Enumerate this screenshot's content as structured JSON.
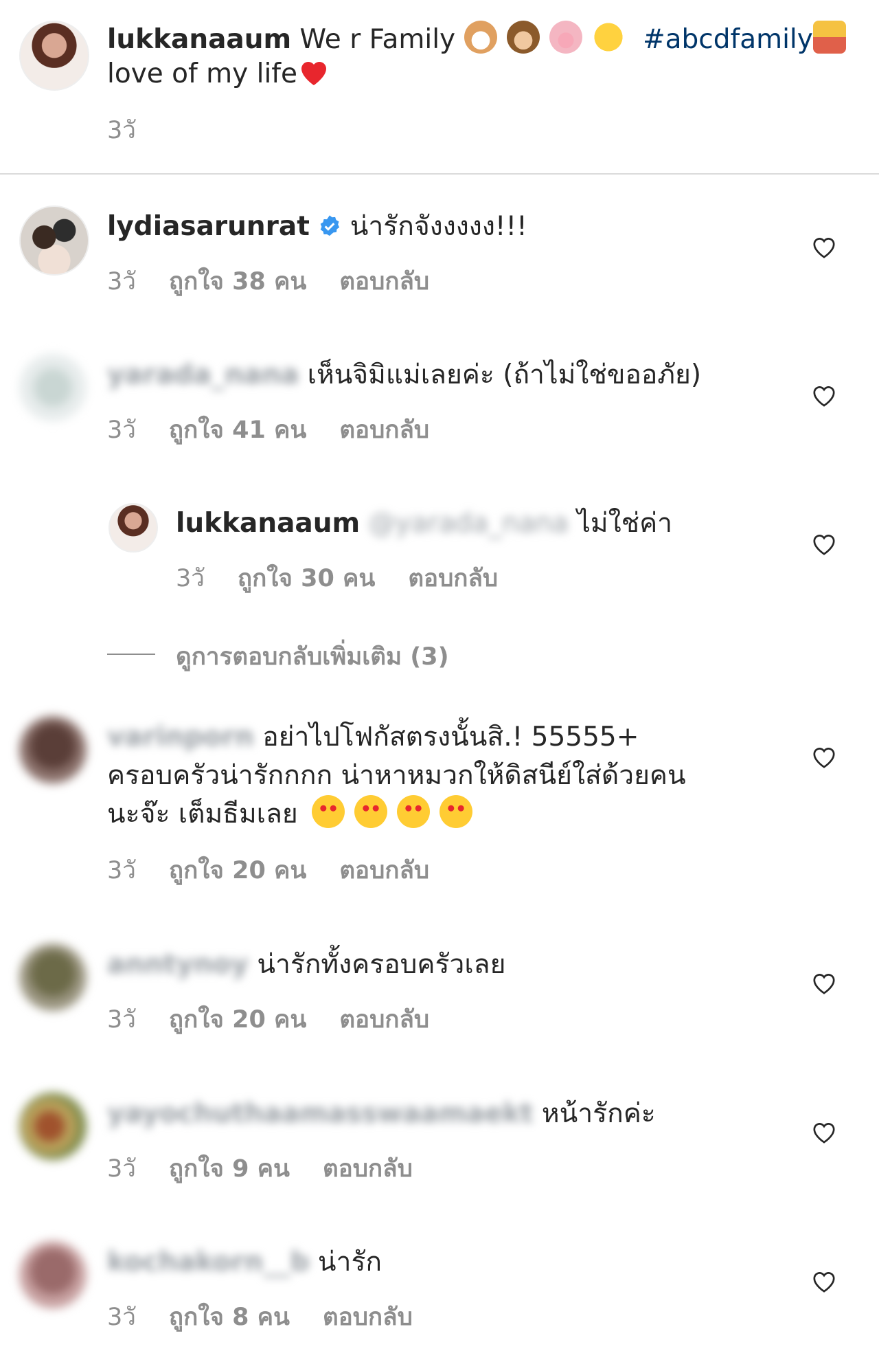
{
  "post": {
    "username": "lukkanaaum",
    "caption_part1": "We r Family",
    "hashtag": "#abcdfamily",
    "caption_part2": "love of my life",
    "time": "3วั"
  },
  "comments": [
    {
      "username": "lydiasarunrat",
      "verified": true,
      "text": "น่ารักจังงงงง!!!",
      "time": "3วั",
      "likes": "ถูกใจ 38 คน",
      "reply": "ตอบกลับ"
    },
    {
      "username": "yarada_nana",
      "text": "เห็นจิมิแม่เลยค่ะ (ถ้าไม่ใช่ขออภัย)",
      "time": "3วั",
      "likes": "ถูกใจ 41 คน",
      "reply": "ตอบกลับ"
    },
    {
      "username": "lukkanaaum",
      "mention": "@yarada_nana",
      "text": "ไม่ใช่ค่า",
      "time": "3วั",
      "likes": "ถูกใจ 30 คน",
      "reply": "ตอบกลับ"
    },
    {
      "username": "varinporn",
      "text_line1": "อย่าไปโฟกัสตรงนั้นสิ.! 55555+",
      "text_line2": "ครอบครัวน่ารักกกก น่าหาหมวกให้ดิสนีย์ใส่ด้วยคน",
      "text_line3": "นะจ๊ะ เต็มธีมเลย",
      "time": "3วั",
      "likes": "ถูกใจ 20 คน",
      "reply": "ตอบกลับ"
    },
    {
      "username": "anntynoy",
      "text": "น่ารักทั้งครอบครัวเลย",
      "time": "3วั",
      "likes": "ถูกใจ 20 คน",
      "reply": "ตอบกลับ"
    },
    {
      "username": "yayochuthaamasswaamaekt",
      "text": "หน้ารักค่ะ",
      "time": "3วั",
      "likes": "ถูกใจ 9 คน",
      "reply": "ตอบกลับ"
    },
    {
      "username": "kochakorn__b",
      "text": "น่ารัก",
      "time": "3วั",
      "likes": "ถูกใจ 8 คน",
      "reply": "ตอบกลับ"
    }
  ],
  "view_more_replies": "ดูการตอบกลับเพิ่มเติม (3)",
  "icons": {
    "heart": "heart-icon",
    "verified": "verified-badge-icon",
    "emoji": [
      "dog-face-emoji",
      "monkey-face-emoji",
      "pig-face-emoji",
      "chick-emoji",
      "family-emoji",
      "red-heart-emoji",
      "heart-eyes-emoji"
    ]
  },
  "colors": {
    "hashtag": "#003569",
    "secondary_text": "#8e8e8e",
    "verified": "#3897f0",
    "divider": "#dbdbdb"
  }
}
